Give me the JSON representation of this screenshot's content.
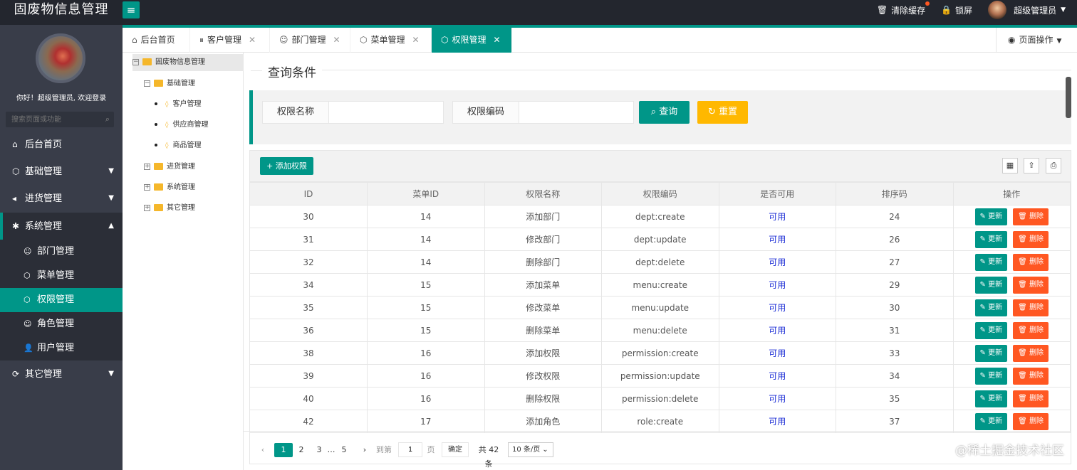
{
  "app": {
    "title": "固废物信息管理",
    "menu_toggle": "≡"
  },
  "header": {
    "clear_cache": "清除缓存",
    "lock": "锁屏",
    "user": "超级管理员"
  },
  "sidebar": {
    "welcome": "你好！超级管理员, 欢迎登录",
    "search_placeholder": "搜索页面或功能",
    "items": [
      {
        "label": "后台首页",
        "icon": "home-icon"
      },
      {
        "label": "基础管理",
        "icon": "cube-icon"
      },
      {
        "label": "进货管理",
        "icon": "speaker-icon"
      },
      {
        "label": "系统管理",
        "icon": "gear-icon"
      },
      {
        "label": "其它管理",
        "icon": "refresh-icon"
      }
    ],
    "sub": [
      {
        "label": "部门管理",
        "icon": "person-icon"
      },
      {
        "label": "菜单管理",
        "icon": "cube-icon"
      },
      {
        "label": "权限管理",
        "icon": "cube-icon"
      },
      {
        "label": "角色管理",
        "icon": "smile-icon"
      },
      {
        "label": "用户管理",
        "icon": "user-icon"
      }
    ]
  },
  "tabs": [
    {
      "label": "后台首页"
    },
    {
      "label": "客户管理"
    },
    {
      "label": "部门管理"
    },
    {
      "label": "菜单管理"
    },
    {
      "label": "权限管理"
    }
  ],
  "page_ops": "页面操作",
  "tree": {
    "root": "固废物信息管理",
    "basic": "基础管理",
    "customer": "客户管理",
    "supplier": "供应商管理",
    "goods": "商品管理",
    "purchase": "进货管理",
    "system": "系统管理",
    "other": "其它管理"
  },
  "query": {
    "legend": "查询条件",
    "name_label": "权限名称",
    "code_label": "权限编码",
    "search_btn": "查询",
    "reset_btn": "重置",
    "name_value": "",
    "code_value": ""
  },
  "table": {
    "add_btn": "添加权限",
    "headers": [
      "ID",
      "菜单ID",
      "权限名称",
      "权限编码",
      "是否可用",
      "排序码",
      "操作"
    ],
    "update_label": "更新",
    "delete_label": "删除",
    "rows": [
      [
        "30",
        "14",
        "添加部门",
        "dept:create",
        "可用",
        "24"
      ],
      [
        "31",
        "14",
        "修改部门",
        "dept:update",
        "可用",
        "26"
      ],
      [
        "32",
        "14",
        "删除部门",
        "dept:delete",
        "可用",
        "27"
      ],
      [
        "34",
        "15",
        "添加菜单",
        "menu:create",
        "可用",
        "29"
      ],
      [
        "35",
        "15",
        "修改菜单",
        "menu:update",
        "可用",
        "30"
      ],
      [
        "36",
        "15",
        "删除菜单",
        "menu:delete",
        "可用",
        "31"
      ],
      [
        "38",
        "16",
        "添加权限",
        "permission:create",
        "可用",
        "33"
      ],
      [
        "39",
        "16",
        "修改权限",
        "permission:update",
        "可用",
        "34"
      ],
      [
        "40",
        "16",
        "删除权限",
        "permission:delete",
        "可用",
        "35"
      ],
      [
        "42",
        "17",
        "添加角色",
        "role:create",
        "可用",
        "37"
      ]
    ]
  },
  "pager": {
    "pages": [
      "1",
      "2",
      "3",
      "…",
      "5"
    ],
    "goto": "到第",
    "page_value": "1",
    "page_unit": "页",
    "confirm": "确定",
    "total": "共 42 条",
    "per_page": "10 条/页"
  },
  "watermark": "@稀土掘金技术社区",
  "colors": {
    "accent": "#009688",
    "warn": "#ffb800",
    "danger": "#ff5722",
    "sidebar": "#393d49"
  }
}
